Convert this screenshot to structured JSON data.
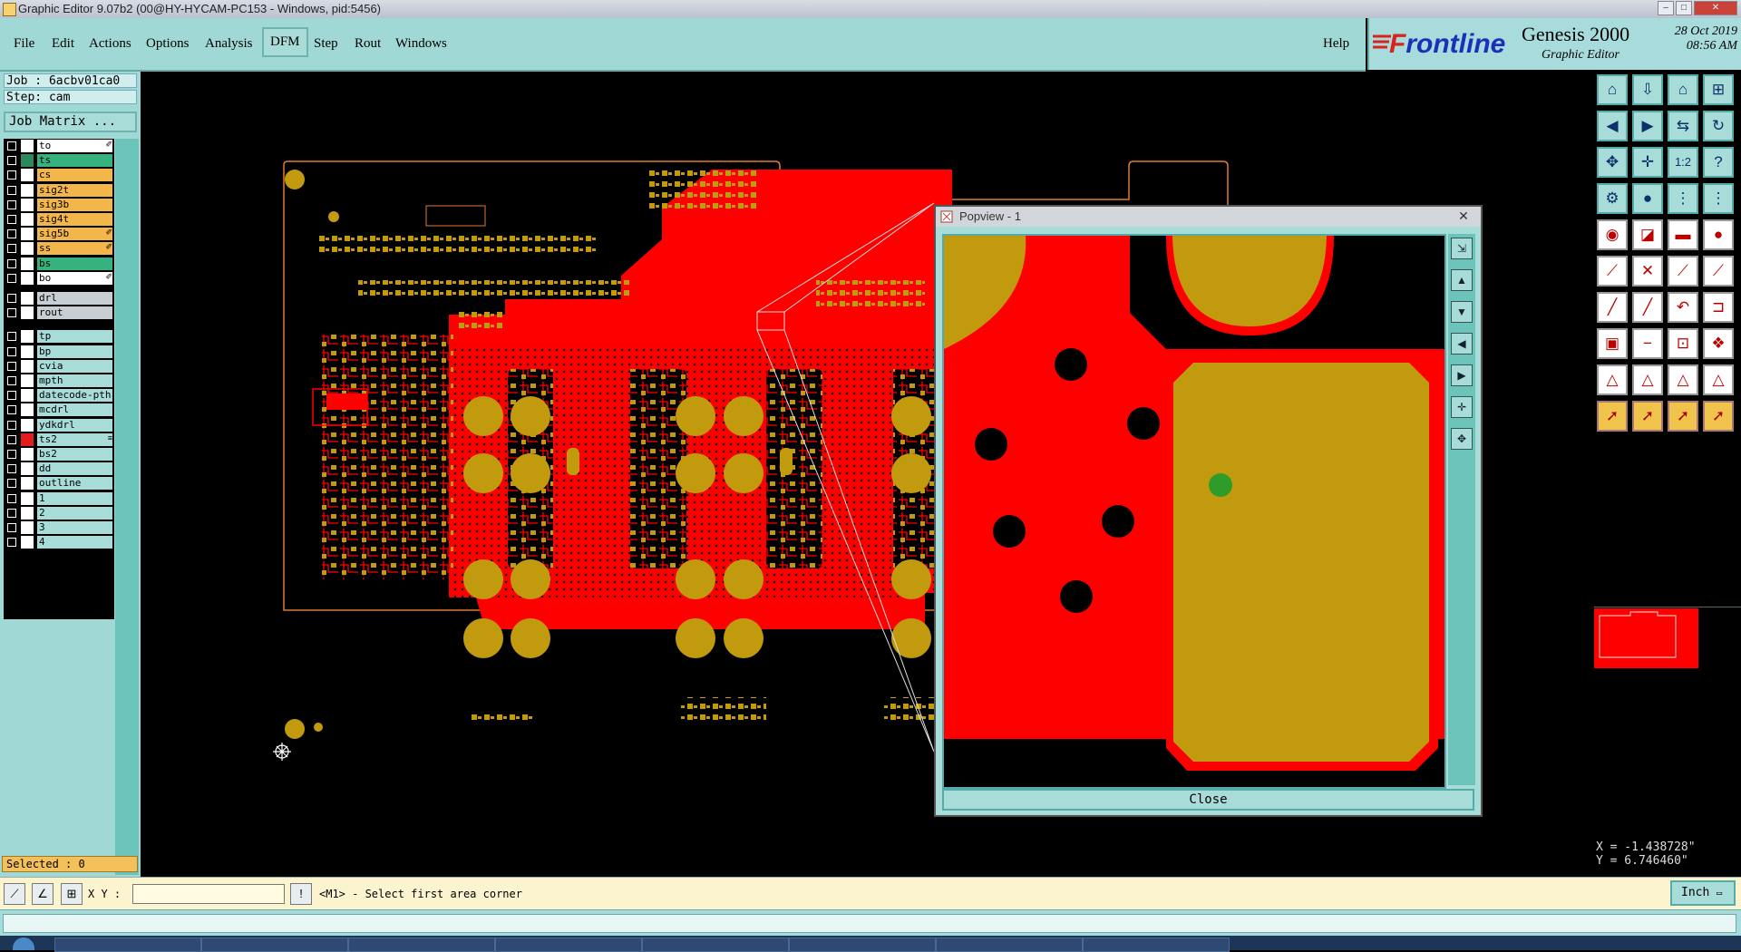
{
  "window": {
    "title": "Graphic Editor 9.07b2 (00@HY-HYCAM-PC153 - Windows, pid:5456)"
  },
  "menu": {
    "items": [
      "File",
      "Edit",
      "Actions",
      "Options",
      "Analysis",
      "DFM",
      "Step",
      "Rout",
      "Windows"
    ],
    "help": "Help"
  },
  "brand": {
    "logo_f": "F",
    "logo_rest": "rontline",
    "product": "Genesis 2000",
    "subtitle": "Graphic Editor",
    "date": "28 Oct 2019",
    "time": "08:56 AM"
  },
  "job": {
    "job_label": "Job : 6acbv01ca0",
    "step_label": "Step: cam",
    "matrix_button": "Job Matrix ..."
  },
  "layers": [
    {
      "name": "to",
      "bg": "#ffffff",
      "sw": "#ffffff",
      "ic": "✐"
    },
    {
      "name": "ts",
      "bg": "#35b27e",
      "sw": "#2b8a5c",
      "ic": ""
    },
    {
      "name": "cs",
      "bg": "#f3b64a",
      "sw": "#ffffff",
      "ic": ""
    },
    {
      "name": "sig2t",
      "bg": "#f3b64a",
      "sw": "#ffffff",
      "ic": ""
    },
    {
      "name": "sig3b",
      "bg": "#f3b64a",
      "sw": "#ffffff",
      "ic": ""
    },
    {
      "name": "sig4t",
      "bg": "#f3b64a",
      "sw": "#ffffff",
      "ic": ""
    },
    {
      "name": "sig5b",
      "bg": "#f3b64a",
      "sw": "#ffffff",
      "ic": "✐"
    },
    {
      "name": "ss",
      "bg": "#f3b64a",
      "sw": "#ffffff",
      "ic": "✐"
    },
    {
      "name": "bs",
      "bg": "#35b27e",
      "sw": "#ffffff",
      "ic": ""
    },
    {
      "name": "bo",
      "bg": "#ffffff",
      "sw": "#ffffff",
      "ic": "✐"
    },
    {
      "name": "drl",
      "bg": "#c7cfd4",
      "sw": "#ffffff",
      "ic": ""
    },
    {
      "name": "rout",
      "bg": "#c7cfd4",
      "sw": "#ffffff",
      "ic": ""
    },
    {
      "name": "tp",
      "bg": "#a8dcd8",
      "sw": "#ffffff",
      "ic": ""
    },
    {
      "name": "bp",
      "bg": "#a8dcd8",
      "sw": "#ffffff",
      "ic": ""
    },
    {
      "name": "cvia",
      "bg": "#a8dcd8",
      "sw": "#ffffff",
      "ic": ""
    },
    {
      "name": "mpth",
      "bg": "#a8dcd8",
      "sw": "#ffffff",
      "ic": ""
    },
    {
      "name": "datecode-pth",
      "bg": "#a8dcd8",
      "sw": "#ffffff",
      "ic": ""
    },
    {
      "name": "mcdrl",
      "bg": "#a8dcd8",
      "sw": "#ffffff",
      "ic": ""
    },
    {
      "name": "ydkdrl",
      "bg": "#a8dcd8",
      "sw": "#ffffff",
      "ic": ""
    },
    {
      "name": "ts2",
      "bg": "#a8dcd8",
      "sw": "#e21b1b",
      "ic": "≡"
    },
    {
      "name": "bs2",
      "bg": "#a8dcd8",
      "sw": "#ffffff",
      "ic": ""
    },
    {
      "name": "dd",
      "bg": "#a8dcd8",
      "sw": "#ffffff",
      "ic": ""
    },
    {
      "name": "outline",
      "bg": "#a8dcd8",
      "sw": "#ffffff",
      "ic": ""
    },
    {
      "name": "1",
      "bg": "#a8dcd8",
      "sw": "#ffffff",
      "ic": ""
    },
    {
      "name": "2",
      "bg": "#a8dcd8",
      "sw": "#ffffff",
      "ic": ""
    },
    {
      "name": "3",
      "bg": "#a8dcd8",
      "sw": "#ffffff",
      "ic": ""
    },
    {
      "name": "4",
      "bg": "#a8dcd8",
      "sw": "#ffffff",
      "ic": ""
    }
  ],
  "selected": "Selected : 0",
  "coords": {
    "x": "X = -1.438728\"",
    "y": "Y =  6.746460\""
  },
  "status": {
    "xy_label": "X Y :",
    "xy_value": "",
    "prompt": "<M1> - Select first area corner",
    "units": "Inch"
  },
  "popview": {
    "title": "Popview - 1",
    "close_label": "Close",
    "close_x": "✕"
  },
  "colors": {
    "copper": "#ff0000",
    "pad": "#c29a0e",
    "background": "#000000",
    "panel": "#9fd8d4"
  }
}
